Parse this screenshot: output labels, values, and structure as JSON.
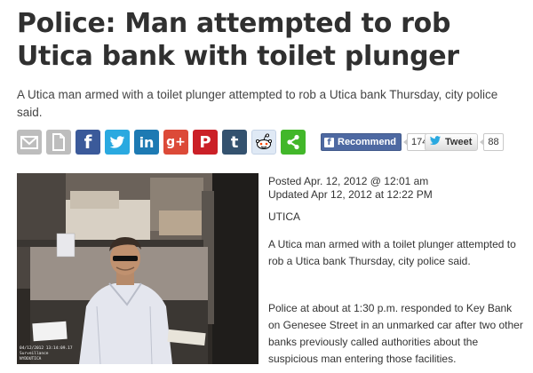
{
  "article": {
    "headline": "Police: Man attempted to rob Utica bank with toilet plunger",
    "dek": "A Utica man armed with a toilet plunger attempted to rob a Utica bank Thursday, city police said.",
    "posted": "Posted Apr. 12, 2012 @ 12:01 am",
    "updated": "Updated Apr 12, 2012 at 12:22 PM",
    "dateline": "UTICA",
    "paragraphs": [
      "A Utica man armed with a toilet plunger attempted to rob a Utica bank Thursday, city police said.",
      "Police at about at 1:30 p.m. responded to Key Bank on Genesee Street in an unmarked car after two other banks previously called authorities about the suspicious man entering those facilities."
    ]
  },
  "share_bar": {
    "buttons": [
      {
        "name": "email",
        "icon": "envelope-icon",
        "color": "#bdbdbd"
      },
      {
        "name": "print",
        "icon": "document-icon",
        "color": "#bdbdbd"
      },
      {
        "name": "facebook",
        "icon": "facebook-icon",
        "glyph": "f",
        "color": "#3b5a9a"
      },
      {
        "name": "twitter",
        "icon": "twitter-bird-icon",
        "color": "#2aa9e0"
      },
      {
        "name": "linkedin",
        "icon": "linkedin-icon",
        "glyph": "in",
        "color": "#1d7ab3"
      },
      {
        "name": "google-plus",
        "icon": "google-plus-icon",
        "glyph": "g+",
        "color": "#dc4a38"
      },
      {
        "name": "pinterest",
        "icon": "pinterest-icon",
        "glyph": "P",
        "color": "#cb2027"
      },
      {
        "name": "tumblr",
        "icon": "tumblr-icon",
        "glyph": "t",
        "color": "#34526f"
      },
      {
        "name": "reddit",
        "icon": "reddit-alien-icon",
        "color": "#dfe9f5"
      },
      {
        "name": "share",
        "icon": "share-icon",
        "color": "#42b72a"
      }
    ]
  },
  "facebook": {
    "label": "Recommend",
    "count": "174",
    "glyph": "f"
  },
  "twitter": {
    "label": "Tweet",
    "count": "88"
  },
  "photo": {
    "caption_lines": [
      "04/12/2012  13:14:09.17",
      "Surveillance",
      "NYDDUTICA"
    ]
  }
}
